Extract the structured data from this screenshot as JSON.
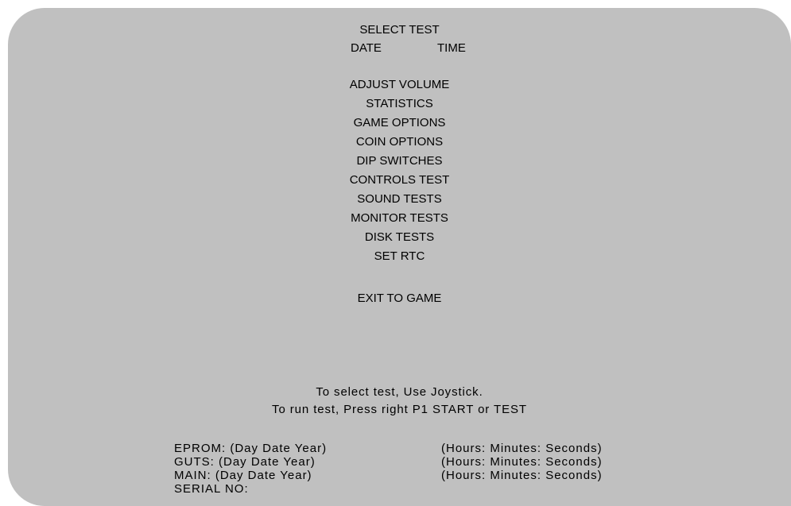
{
  "screen": {
    "title": "SELECT TEST",
    "date_label": "DATE",
    "time_label": "TIME"
  },
  "menu": {
    "items": [
      {
        "label": "ADJUST VOLUME"
      },
      {
        "label": "STATISTICS"
      },
      {
        "label": "GAME OPTIONS"
      },
      {
        "label": "COIN OPTIONS"
      },
      {
        "label": "DIP SWITCHES"
      },
      {
        "label": "CONTROLS TEST"
      },
      {
        "label": "SOUND TESTS"
      },
      {
        "label": "MONITOR TESTS"
      },
      {
        "label": "DISK TESTS"
      },
      {
        "label": "SET RTC"
      }
    ],
    "exit_label": "EXIT TO GAME"
  },
  "instructions": {
    "line1": "To select test, Use Joystick.",
    "line2": "To run test, Press right P1 START or TEST"
  },
  "versions": {
    "eprom": {
      "left": "EPROM: (Day Date Year)",
      "right": "(Hours: Minutes: Seconds)"
    },
    "guts": {
      "left": "GUTS: (Day Date Year)",
      "right": "(Hours: Minutes: Seconds)"
    },
    "main": {
      "left": "MAIN: (Day Date Year)",
      "right": "(Hours: Minutes: Seconds)"
    },
    "serial_label": "SERIAL NO:"
  },
  "colors": {
    "screen_background": "#c0c0c0",
    "text": "#000000",
    "page_background": "#ffffff"
  }
}
